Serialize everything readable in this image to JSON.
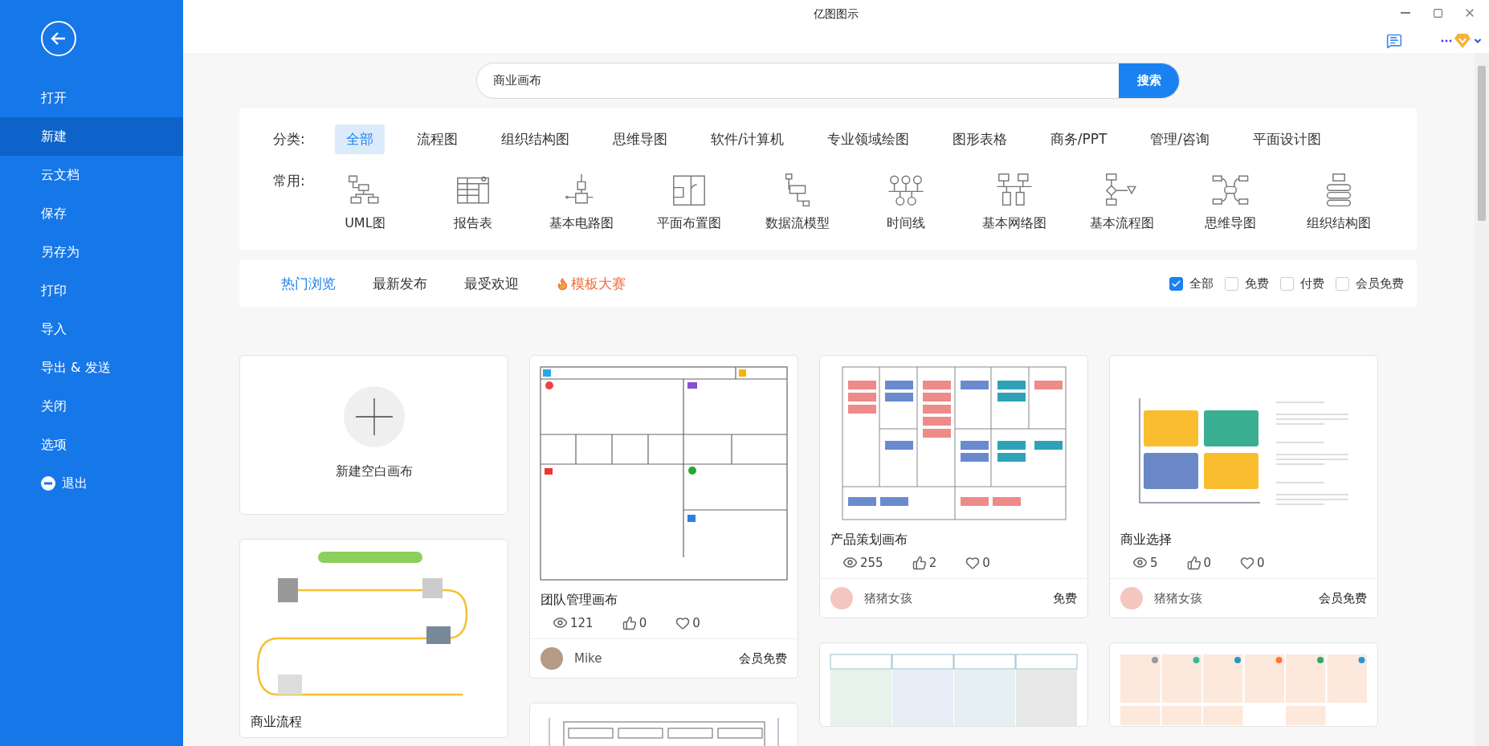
{
  "window": {
    "title": "亿图图示"
  },
  "sidebar": {
    "items": [
      {
        "label": "打开",
        "kind": "plain",
        "selected": false
      },
      {
        "label": "新建",
        "kind": "plain",
        "selected": true
      },
      {
        "label": "云文档",
        "kind": "plain",
        "selected": false
      },
      {
        "label": "保存",
        "kind": "plain",
        "selected": false
      },
      {
        "label": "另存为",
        "kind": "plain",
        "selected": false
      },
      {
        "label": "打印",
        "kind": "plain",
        "selected": false
      },
      {
        "label": "导入",
        "kind": "plain",
        "selected": false
      },
      {
        "label": "导出 & 发送",
        "kind": "plain",
        "selected": false
      },
      {
        "label": "关闭",
        "kind": "plain",
        "selected": false
      },
      {
        "label": "选项",
        "kind": "plain",
        "selected": false
      },
      {
        "label": "退出",
        "kind": "exit",
        "selected": false
      }
    ]
  },
  "search": {
    "value": "商业画布",
    "button": "搜索"
  },
  "categories": {
    "label": "分类:",
    "items": [
      {
        "label": "全部",
        "selected": true
      },
      {
        "label": "流程图",
        "selected": false
      },
      {
        "label": "组织结构图",
        "selected": false
      },
      {
        "label": "思维导图",
        "selected": false
      },
      {
        "label": "软件/计算机",
        "selected": false
      },
      {
        "label": "专业领域绘图",
        "selected": false
      },
      {
        "label": "图形表格",
        "selected": false
      },
      {
        "label": "商务/PPT",
        "selected": false
      },
      {
        "label": "管理/咨询",
        "selected": false
      },
      {
        "label": "平面设计图",
        "selected": false
      }
    ]
  },
  "common": {
    "label": "常用:",
    "items": [
      {
        "label": "UML图",
        "kind": "uml"
      },
      {
        "label": "报告表",
        "kind": "report"
      },
      {
        "label": "基本电路图",
        "kind": "circuit"
      },
      {
        "label": "平面布置图",
        "kind": "floorplan"
      },
      {
        "label": "数据流模型",
        "kind": "dataflow"
      },
      {
        "label": "时间线",
        "kind": "timeline"
      },
      {
        "label": "基本网络图",
        "kind": "network"
      },
      {
        "label": "基本流程图",
        "kind": "flowchart"
      },
      {
        "label": "思维导图",
        "kind": "mindmap"
      },
      {
        "label": "组织结构图",
        "kind": "org"
      }
    ]
  },
  "tabs": [
    {
      "label": "热门浏览",
      "kind": "plain",
      "selected": true
    },
    {
      "label": "最新发布",
      "kind": "plain",
      "selected": false
    },
    {
      "label": "最受欢迎",
      "kind": "plain",
      "selected": false
    },
    {
      "label": "模板大赛",
      "kind": "contest",
      "selected": false
    }
  ],
  "filters": [
    {
      "label": "全部",
      "checked": true
    },
    {
      "label": "免费",
      "checked": false
    },
    {
      "label": "付费",
      "checked": false
    },
    {
      "label": "会员免费",
      "checked": false
    }
  ],
  "columns": [
    [
      {
        "kind": "new",
        "label": "新建空白画布"
      },
      {
        "kind": "process",
        "title": "商业流程"
      }
    ],
    [
      {
        "kind": "team",
        "title": "团队管理画布",
        "views": "121",
        "likes": "0",
        "favorites": "0",
        "author": "Mike",
        "price": "会员免费"
      },
      {
        "kind": "blocks"
      }
    ],
    [
      {
        "kind": "product",
        "title": "产品策划画布",
        "views": "255",
        "likes": "2",
        "favorites": "0",
        "author": "猪猪女孩",
        "price": "免费"
      },
      {
        "kind": "columns"
      }
    ],
    [
      {
        "kind": "choice",
        "title": "商业选择",
        "views": "5",
        "likes": "0",
        "favorites": "0",
        "author": "猪猪女孩",
        "price": "会员免费"
      },
      {
        "kind": "peach"
      }
    ]
  ]
}
